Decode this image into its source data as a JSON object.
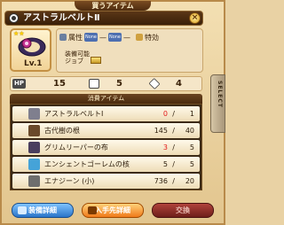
{
  "header": {
    "banner": "買うアイテム",
    "item_name": "アストラルベルトⅡ"
  },
  "item": {
    "level": "Lv.1",
    "stars": "★★",
    "attr_label": "属性",
    "attr_values": [
      "None",
      "None"
    ],
    "special_label": "特効",
    "job_label_1": "装備可能",
    "job_label_2": "ジョブ"
  },
  "stats": {
    "hp_label": "HP",
    "hp": "15",
    "def": "5",
    "mdef": "4"
  },
  "materials": {
    "header": "消費アイテム",
    "items": [
      {
        "name": "アストラルベルトⅠ",
        "owned": "0",
        "required": "1",
        "short": true,
        "color": "#7f7f8e"
      },
      {
        "name": "古代樹の根",
        "owned": "145",
        "required": "40",
        "short": false,
        "color": "#6a4a2a"
      },
      {
        "name": "グリムリーパーの布",
        "owned": "3",
        "required": "5",
        "short": true,
        "color": "#4a3e5e"
      },
      {
        "name": "エンシェントゴーレムの核",
        "owned": "5",
        "required": "5",
        "short": false,
        "color": "#45a3d8"
      },
      {
        "name": "エナジーン (小)",
        "owned": "736",
        "required": "20",
        "short": false,
        "color": "#6e6e6e"
      }
    ]
  },
  "side_tab": "SELECT",
  "buttons": {
    "detail": "装備詳細",
    "where": "入手先詳細",
    "trade": "交換"
  }
}
